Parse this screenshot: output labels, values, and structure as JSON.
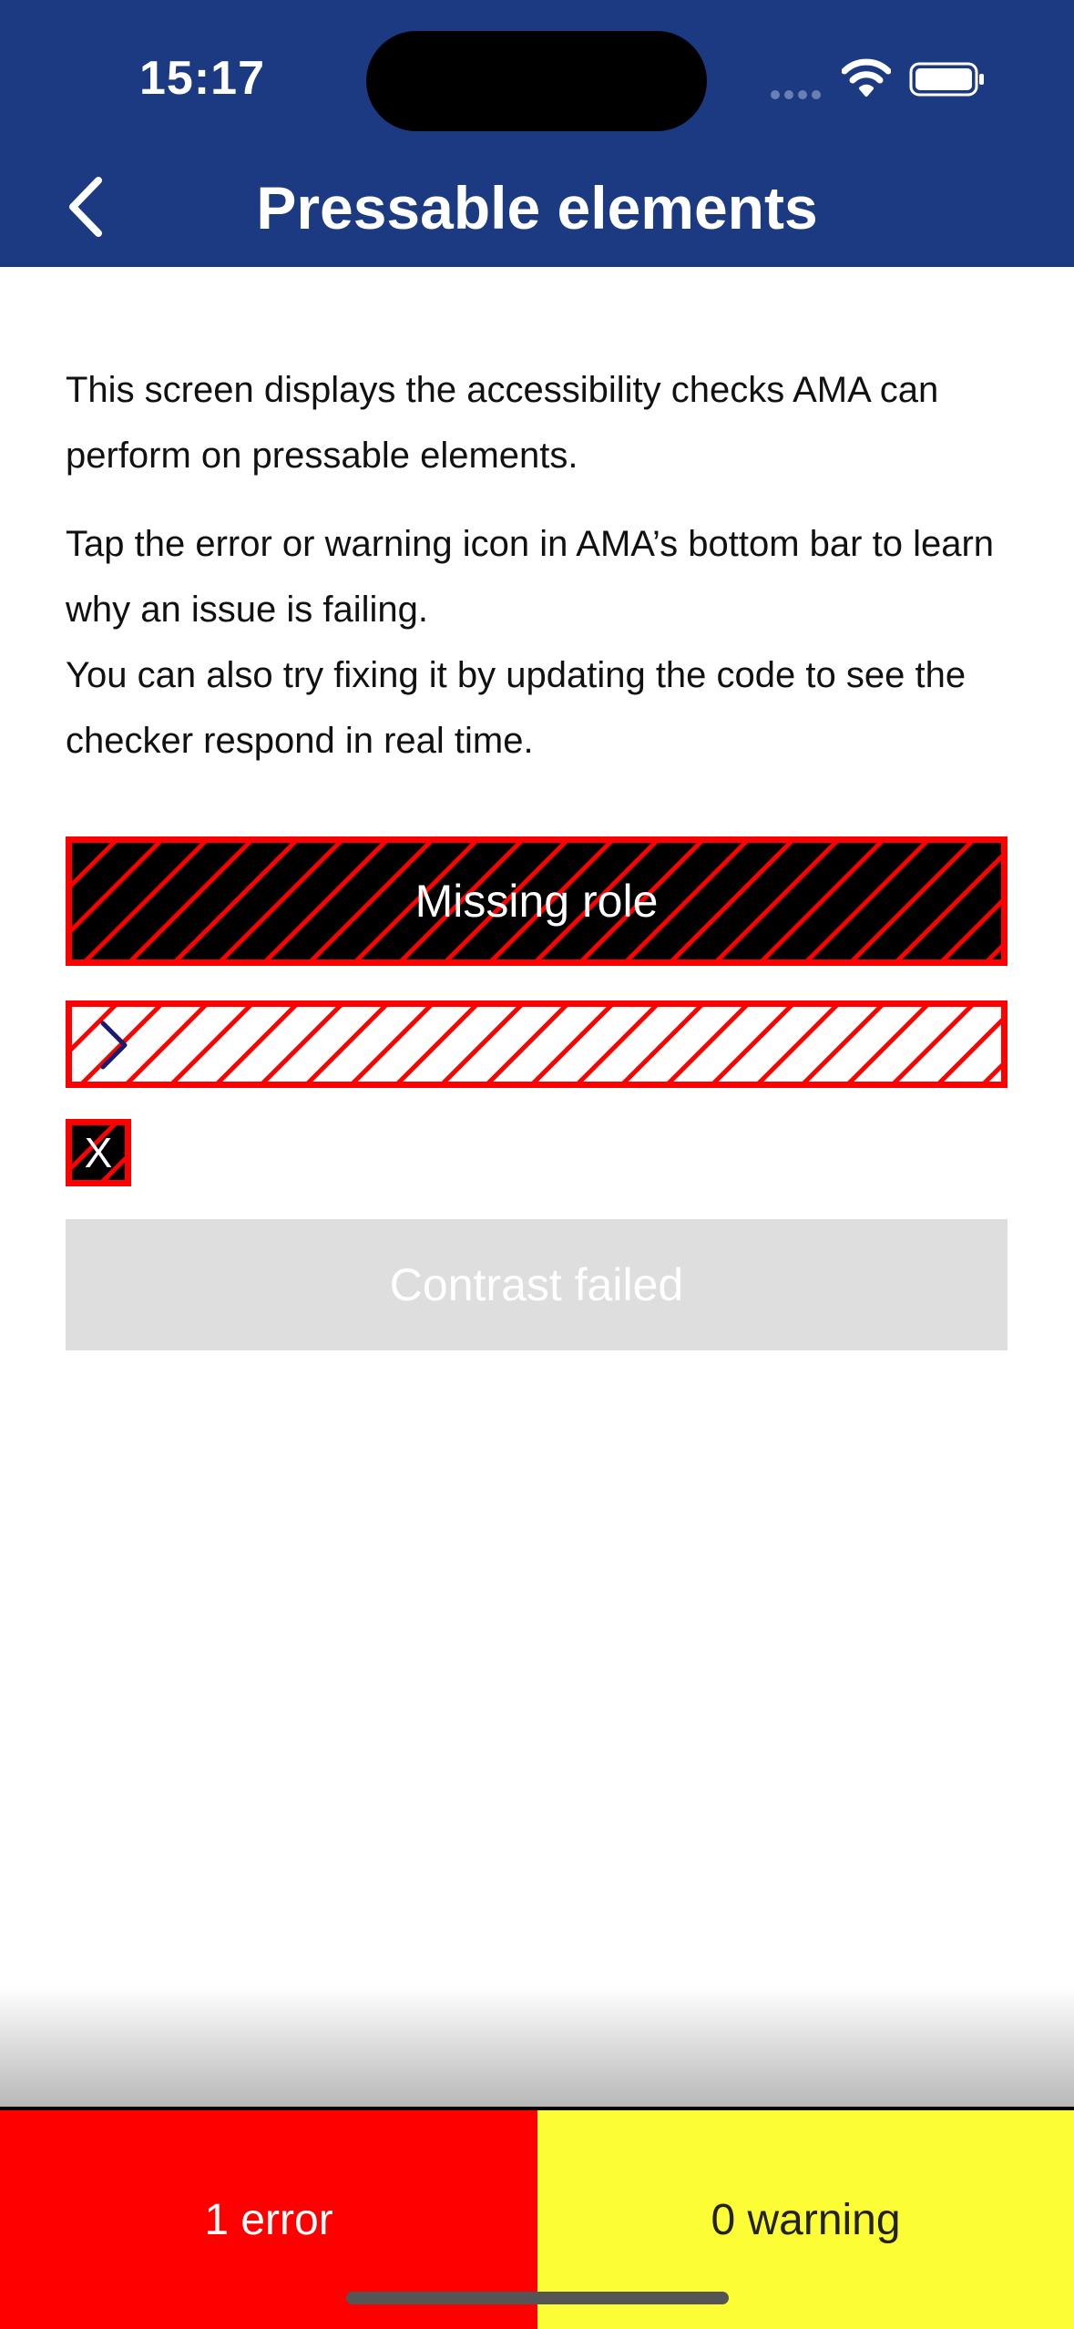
{
  "status_bar": {
    "time": "15:17"
  },
  "header": {
    "title": "Pressable elements"
  },
  "description": {
    "paragraph1": "This screen displays the accessibility checks AMA can perform on pressable elements.",
    "paragraph2_line1": "Tap the error or warning icon in AMA’s bottom bar to learn why an issue is failing.",
    "paragraph2_line2": "You can also try fixing it by updating the code to see the checker respond in real time."
  },
  "buttons": {
    "missing_role_label": "Missing role",
    "x_label": "X",
    "contrast_label": "Contrast failed"
  },
  "bottom_bar": {
    "error_label": "1 error",
    "warning_label": "0 warning",
    "error_color": "#ff0000",
    "warning_color": "#fdfd35"
  },
  "colors": {
    "header_bg": "#1b3a82",
    "highlight_border": "#ff0000"
  }
}
